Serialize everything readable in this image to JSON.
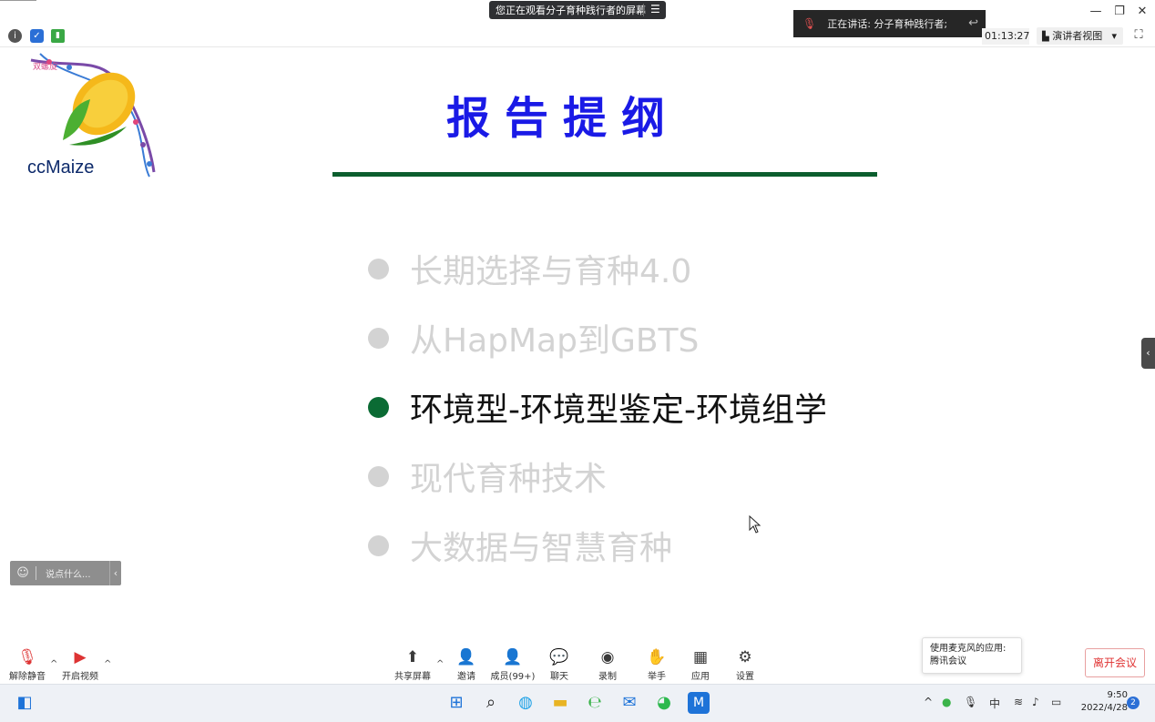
{
  "window": {
    "share_banner": "您正在观看分子育种践行者的屏幕",
    "banner_menu_icon": "menu-icon",
    "minimize": "—",
    "restore": "❐",
    "close": "✕"
  },
  "toolbar": {
    "speaking_text": "正在讲话: 分子育种践行者;",
    "timer": "01:13:27",
    "view_mode": "演讲者视图",
    "view_mode_caret": "▾"
  },
  "slide": {
    "logo_text": "ccMaize",
    "logo_small_text": "双螺旋",
    "title": "报告提纲",
    "outline": [
      {
        "text": "长期选择与育种4.0",
        "active": false
      },
      {
        "text": "从HapMap到GBTS",
        "active": false
      },
      {
        "text": "环境型-环境型鉴定-环境组学",
        "active": true
      },
      {
        "text": "现代育种技术",
        "active": false
      },
      {
        "text": "大数据与智慧育种",
        "active": false
      }
    ],
    "colors": {
      "title": "#1a1ae6",
      "rule": "#0b5e2e",
      "active_dot": "#0b6b34",
      "dim": "#d3d3d3"
    }
  },
  "chat": {
    "placeholder": "说点什么...",
    "arrow": "‹"
  },
  "meeting_toolbar": {
    "unmute": "解除静音",
    "start_video": "开启视频",
    "share_screen": "共享屏幕",
    "invite": "邀请",
    "members": "成员(99+)",
    "chat": "聊天",
    "record": "录制",
    "raise_hand": "举手",
    "apps": "应用",
    "settings": "设置",
    "leave": "离开会议",
    "mic_notice_line1": "使用麦克风的应用:",
    "mic_notice_line2": "腾讯会议"
  },
  "taskbar": {
    "ime": "中",
    "time": "9:50",
    "date": "2022/4/28",
    "notifications": "2"
  }
}
